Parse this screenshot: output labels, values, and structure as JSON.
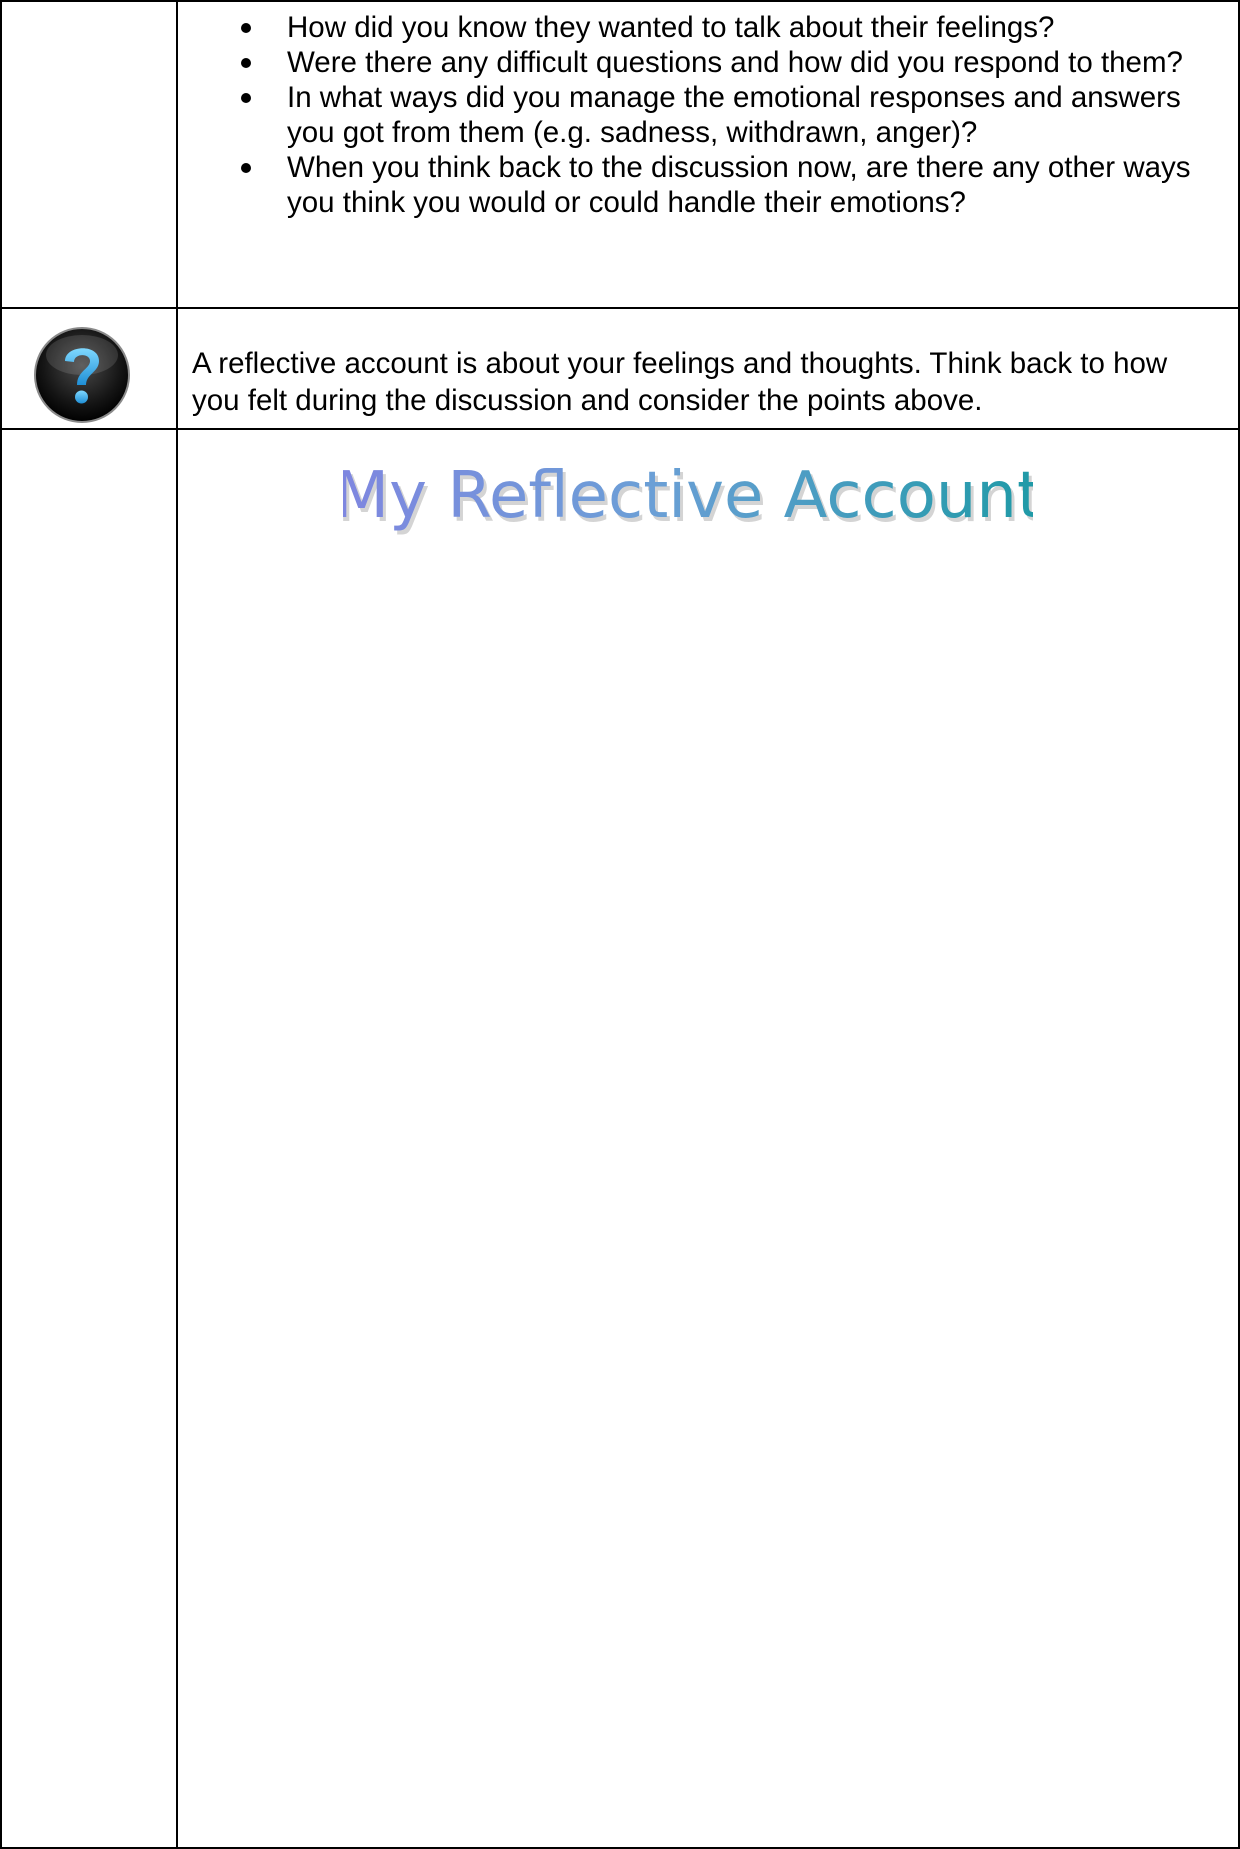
{
  "prompts": {
    "items": [
      "How did you know they wanted to talk about their feelings?",
      "Were there any difficult questions and how did you respond to them?",
      "In what ways did you manage the emotional responses and answers you got from them (e.g. sadness, withdrawn, anger)?",
      "When you think back to the discussion now, are there any other ways you think you would or could handle their emotions?"
    ]
  },
  "info": {
    "icon": "question-mark-icon",
    "text": "A reflective account is about your feelings and thoughts. Think back to how you felt during the discussion and consider the points above."
  },
  "account": {
    "title": "My Reflective Account",
    "title_colors": [
      "#7f86e0",
      "#1e9aa6"
    ]
  }
}
